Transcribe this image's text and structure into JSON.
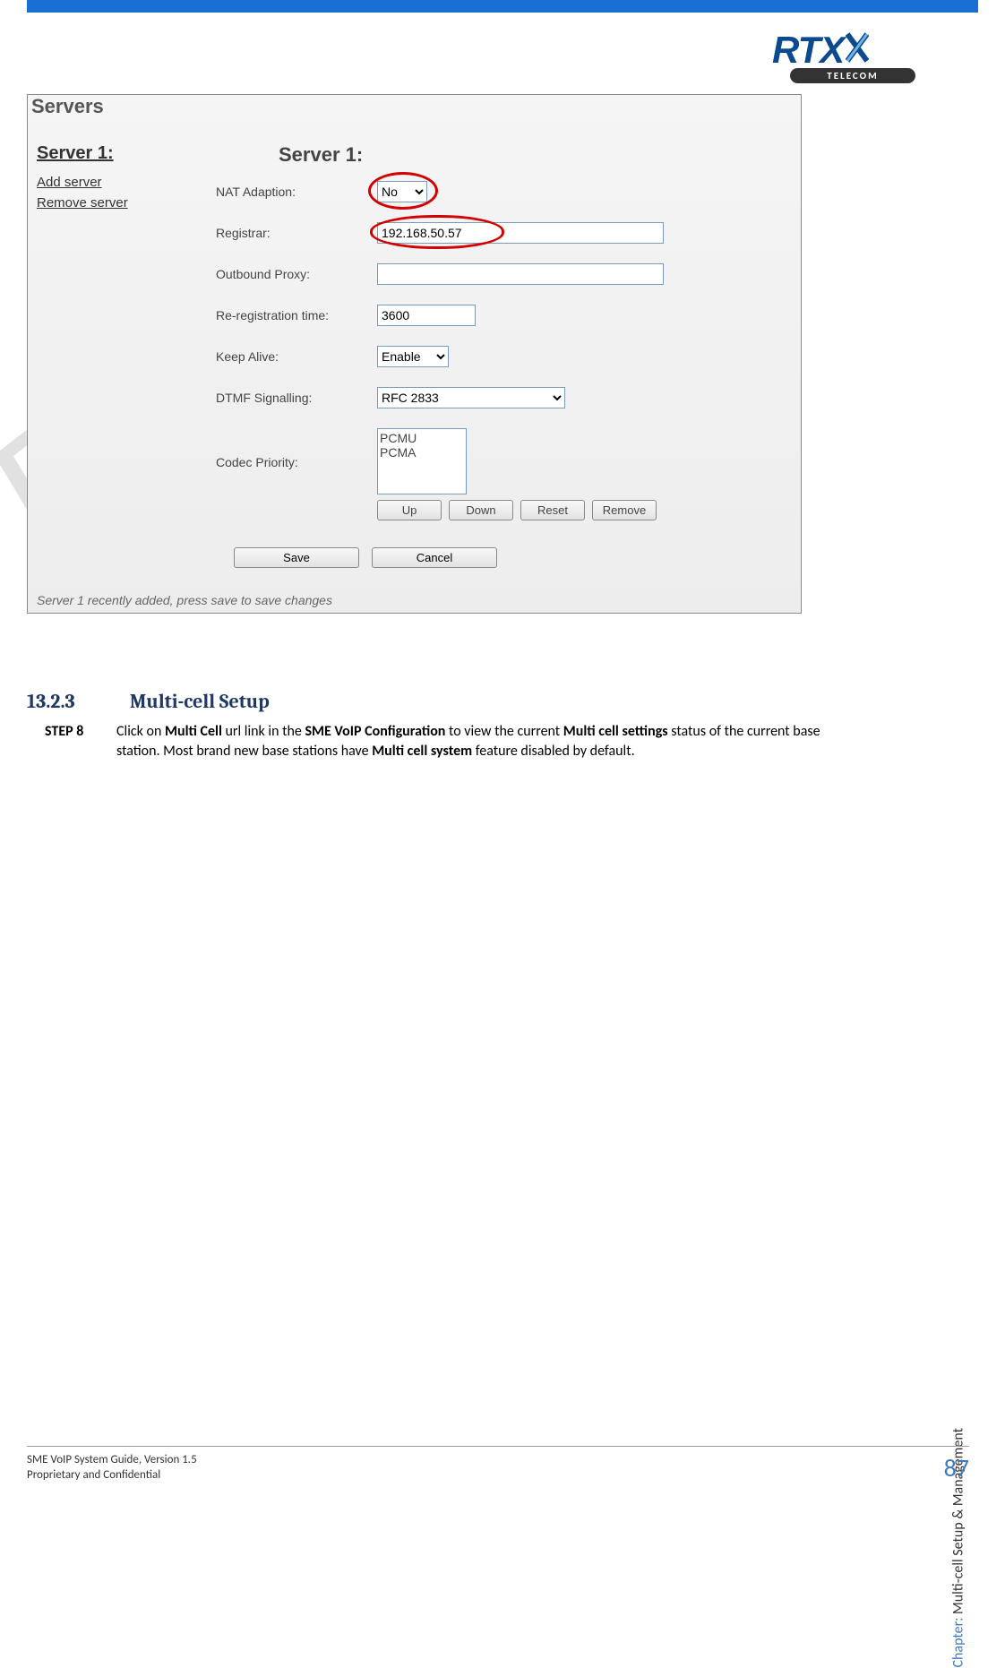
{
  "logo": {
    "brand": "RTX",
    "sub": "TELECOM"
  },
  "screenshot": {
    "title": "Servers",
    "sidebar": {
      "heading": "Server 1:",
      "links": [
        "Add server",
        "Remove server"
      ]
    },
    "main_title": "Server 1:",
    "fields": {
      "nat_label": "NAT Adaption:",
      "nat_value": "No",
      "registrar_label": "Registrar:",
      "registrar_value": "192.168.50.57",
      "proxy_label": "Outbound Proxy:",
      "proxy_value": "",
      "rereg_label": "Re-registration time:",
      "rereg_value": "3600",
      "keepalive_label": "Keep Alive:",
      "keepalive_value": "Enable",
      "dtmf_label": "DTMF Signalling:",
      "dtmf_value": "RFC 2833",
      "codec_label": "Codec Priority:",
      "codec_items": [
        "PCMU",
        "PCMA"
      ]
    },
    "buttons": {
      "up": "Up",
      "down": "Down",
      "reset": "Reset",
      "remove": "Remove",
      "save": "Save",
      "cancel": "Cancel"
    },
    "status": "Server 1 recently added, press save to save changes"
  },
  "section": {
    "number": "13.2.3",
    "title": "Multi-cell Setup",
    "step_label": "STEP 8",
    "step_parts": {
      "p1": "Click on ",
      "b1": "Multi Cell",
      "p2": "  url link in the ",
      "b2": "SME VoIP Configuration",
      "p3": "  to view the current ",
      "b3": "Multi cell settings",
      "p4": " status of the current base station. Most  brand new base stations have ",
      "b4": "Multi cell system",
      "p5": " feature disabled by default."
    }
  },
  "watermark": "Review",
  "chapter": {
    "prefix": "Chapter:",
    "name": " Multi-cell Setup & Management"
  },
  "footer": {
    "line1": "SME VoIP System Guide, Version 1.5",
    "line2": "Proprietary and Confidential",
    "page": "87"
  }
}
